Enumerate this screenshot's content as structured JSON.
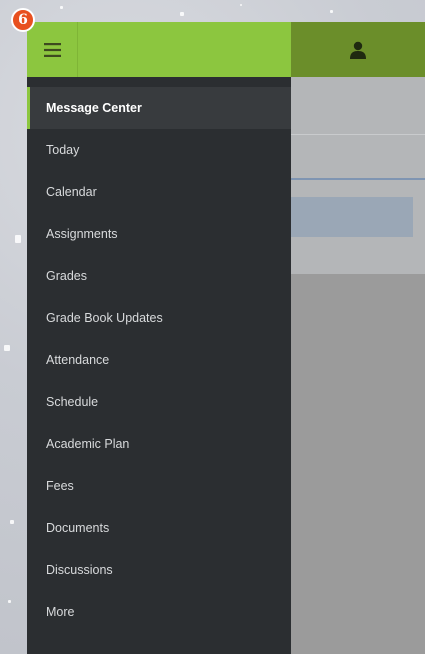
{
  "badge": {
    "step_number": "6",
    "color": "#e8501f"
  },
  "header": {
    "menu_icon": "hamburger-menu-icon",
    "user_icon": "user-icon",
    "accent_color": "#8cc63f",
    "secondary_color": "#6b8e2a"
  },
  "drawer": {
    "active_index": 0,
    "items": [
      {
        "label": "Message Center"
      },
      {
        "label": "Today"
      },
      {
        "label": "Calendar"
      },
      {
        "label": "Assignments"
      },
      {
        "label": "Grades"
      },
      {
        "label": "Grade Book Updates"
      },
      {
        "label": "Attendance"
      },
      {
        "label": "Schedule"
      },
      {
        "label": "Academic Plan"
      },
      {
        "label": "Fees"
      },
      {
        "label": "Documents"
      },
      {
        "label": "Discussions"
      },
      {
        "label": "More"
      }
    ]
  }
}
